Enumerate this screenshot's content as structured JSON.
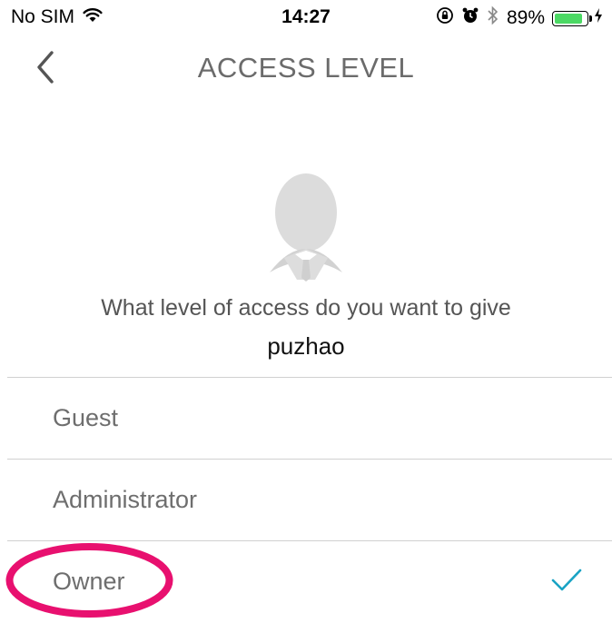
{
  "status_bar": {
    "carrier": "No SIM",
    "time": "14:27",
    "battery_percent": "89%",
    "battery_level": 0.89,
    "icons": [
      "wifi-icon",
      "orientation-lock-icon",
      "alarm-icon",
      "bluetooth-icon",
      "battery-icon",
      "charging-icon"
    ]
  },
  "nav": {
    "title": "ACCESS LEVEL",
    "back_icon": "chevron-left-icon"
  },
  "prompt": {
    "question": "What level of access do you want to give",
    "username": "puzhao"
  },
  "access_levels": [
    {
      "label": "Guest",
      "selected": false
    },
    {
      "label": "Administrator",
      "selected": false
    },
    {
      "label": "Owner",
      "selected": true
    }
  ],
  "colors": {
    "accent": "#1aa3c4",
    "highlight": "#e8106f",
    "battery": "#4cd964"
  }
}
